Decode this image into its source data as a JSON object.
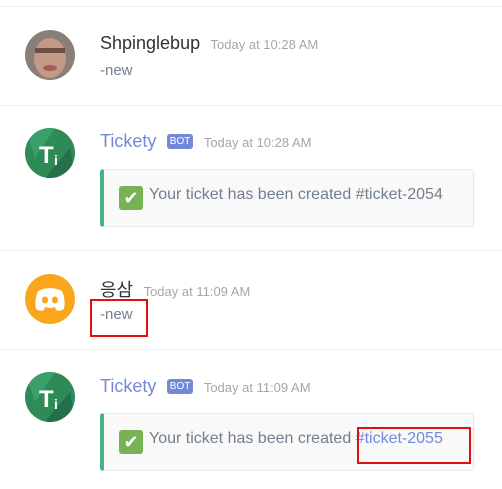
{
  "messages": [
    {
      "username": "Shpinglebup",
      "timestamp": "Today at 10:28 AM",
      "content": "-new",
      "avatar": "user-photo-avatar"
    },
    {
      "username": "Tickety",
      "bot_tag": "BOT",
      "timestamp": "Today at 10:28 AM",
      "embed_text": "Your ticket has been created",
      "embed_channel": "#ticket-2054",
      "avatar": "tickety-bot-avatar"
    },
    {
      "username": "응삼",
      "timestamp": "Today at 11:09 AM",
      "content": "-new",
      "avatar": "discord-default-avatar"
    },
    {
      "username": "Tickety",
      "bot_tag": "BOT",
      "timestamp": "Today at 11:09 AM",
      "embed_text": "Your ticket has been created",
      "embed_channel": "#ticket-2055",
      "avatar": "tickety-bot-avatar"
    }
  ],
  "colors": {
    "bot_name": "#7289da",
    "embed_border": "#43b581",
    "highlight_box": "#e01010",
    "check_emoji": "#77b255"
  },
  "icons": {
    "check": "white-heavy-check-mark-icon"
  }
}
